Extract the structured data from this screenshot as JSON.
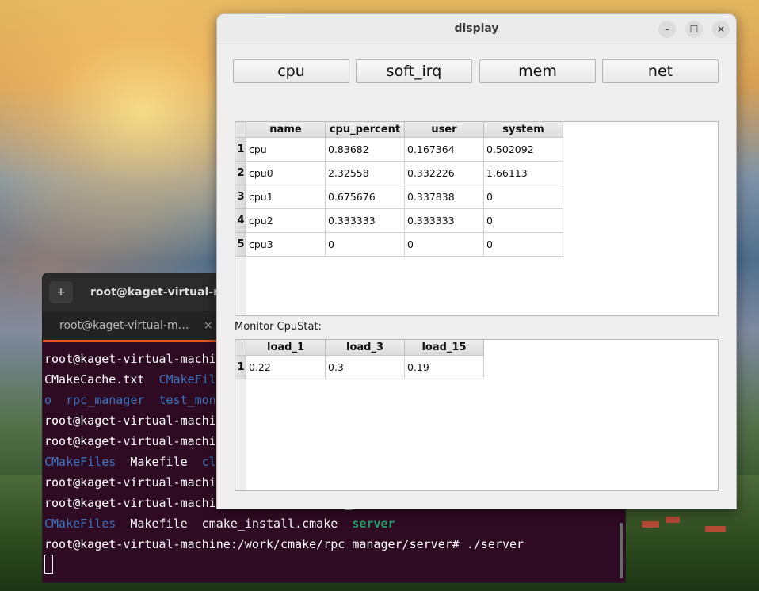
{
  "display_window": {
    "title": "display",
    "controls": {
      "minimize": "–",
      "maximize": "☐",
      "close": "✕"
    },
    "buttons": [
      "cpu",
      "soft_irq",
      "mem",
      "net"
    ],
    "cpu_table": {
      "columns": [
        "name",
        "cpu_percent",
        "user",
        "system"
      ],
      "row_headers": [
        "1",
        "2",
        "3",
        "4",
        "5"
      ],
      "rows": [
        [
          "cpu",
          "0.83682",
          "0.167364",
          "0.502092"
        ],
        [
          "cpu0",
          "2.32558",
          "0.332226",
          "1.66113"
        ],
        [
          "cpu1",
          "0.675676",
          "0.337838",
          "0"
        ],
        [
          "cpu2",
          "0.333333",
          "0.333333",
          "0"
        ],
        [
          "cpu3",
          "0",
          "0",
          "0"
        ]
      ]
    },
    "monitor_label": "Monitor CpuStat:",
    "load_table": {
      "columns": [
        "load_1",
        "load_3",
        "load_15"
      ],
      "row_headers": [
        "1"
      ],
      "rows": [
        [
          "0.22",
          "0.3",
          "0.19"
        ]
      ]
    }
  },
  "terminal": {
    "header_title": "root@kaget-virtual-machine: /work/cmake/rpc_manager/server",
    "new_tab_icon": "+",
    "tab_label": "root@kaget-virtual-machine: /work/cmake",
    "tab_close": "×",
    "lines": [
      [
        {
          "t": "root@kaget-virtual-machine:/work/cmake/rpc_manager# ls",
          "c": ""
        }
      ],
      [
        {
          "t": "CMakeCache.txt  ",
          "c": ""
        },
        {
          "t": "CMakeFiles",
          "c": "blue"
        }
      ],
      [
        {
          "t": "o  ",
          "c": "blue"
        },
        {
          "t": "rpc_manager",
          "c": "blue"
        },
        {
          "t": "  ",
          "c": ""
        },
        {
          "t": "test_monitor",
          "c": "blue"
        }
      ],
      [
        {
          "t": "root@kaget-virtual-machine:/work/cmake/rpc_manager# cd server",
          "c": ""
        }
      ],
      [
        {
          "t": "root@kaget-virtual-machine:/work/cmake/rpc_manager/server# ls",
          "c": ""
        }
      ],
      [
        {
          "t": "CMakeFiles",
          "c": "blue"
        },
        {
          "t": "  Makefile  ",
          "c": ""
        },
        {
          "t": "client",
          "c": "blue"
        }
      ],
      [
        {
          "t": "root@kaget-virtual-machine:/work/cmake/rpc_manager/server# make",
          "c": ""
        }
      ],
      [
        {
          "t": "root@kaget-virtual-machine:/work/cmake/rpc_manager/server# ls",
          "c": ""
        }
      ],
      [
        {
          "t": "CMakeFiles",
          "c": "blue"
        },
        {
          "t": "  Makefile  cmake_install.cmake  ",
          "c": ""
        },
        {
          "t": "server",
          "c": "green"
        }
      ],
      [
        {
          "t": "root@kaget-virtual-machine:/work/cmake/rpc_manager/server# ./server",
          "c": ""
        }
      ]
    ]
  },
  "colors": {
    "terminal_bg": "#2f0b23",
    "dir_blue": "#3a74c0",
    "exec_green": "#26a269",
    "tab_accent": "#e95420"
  }
}
